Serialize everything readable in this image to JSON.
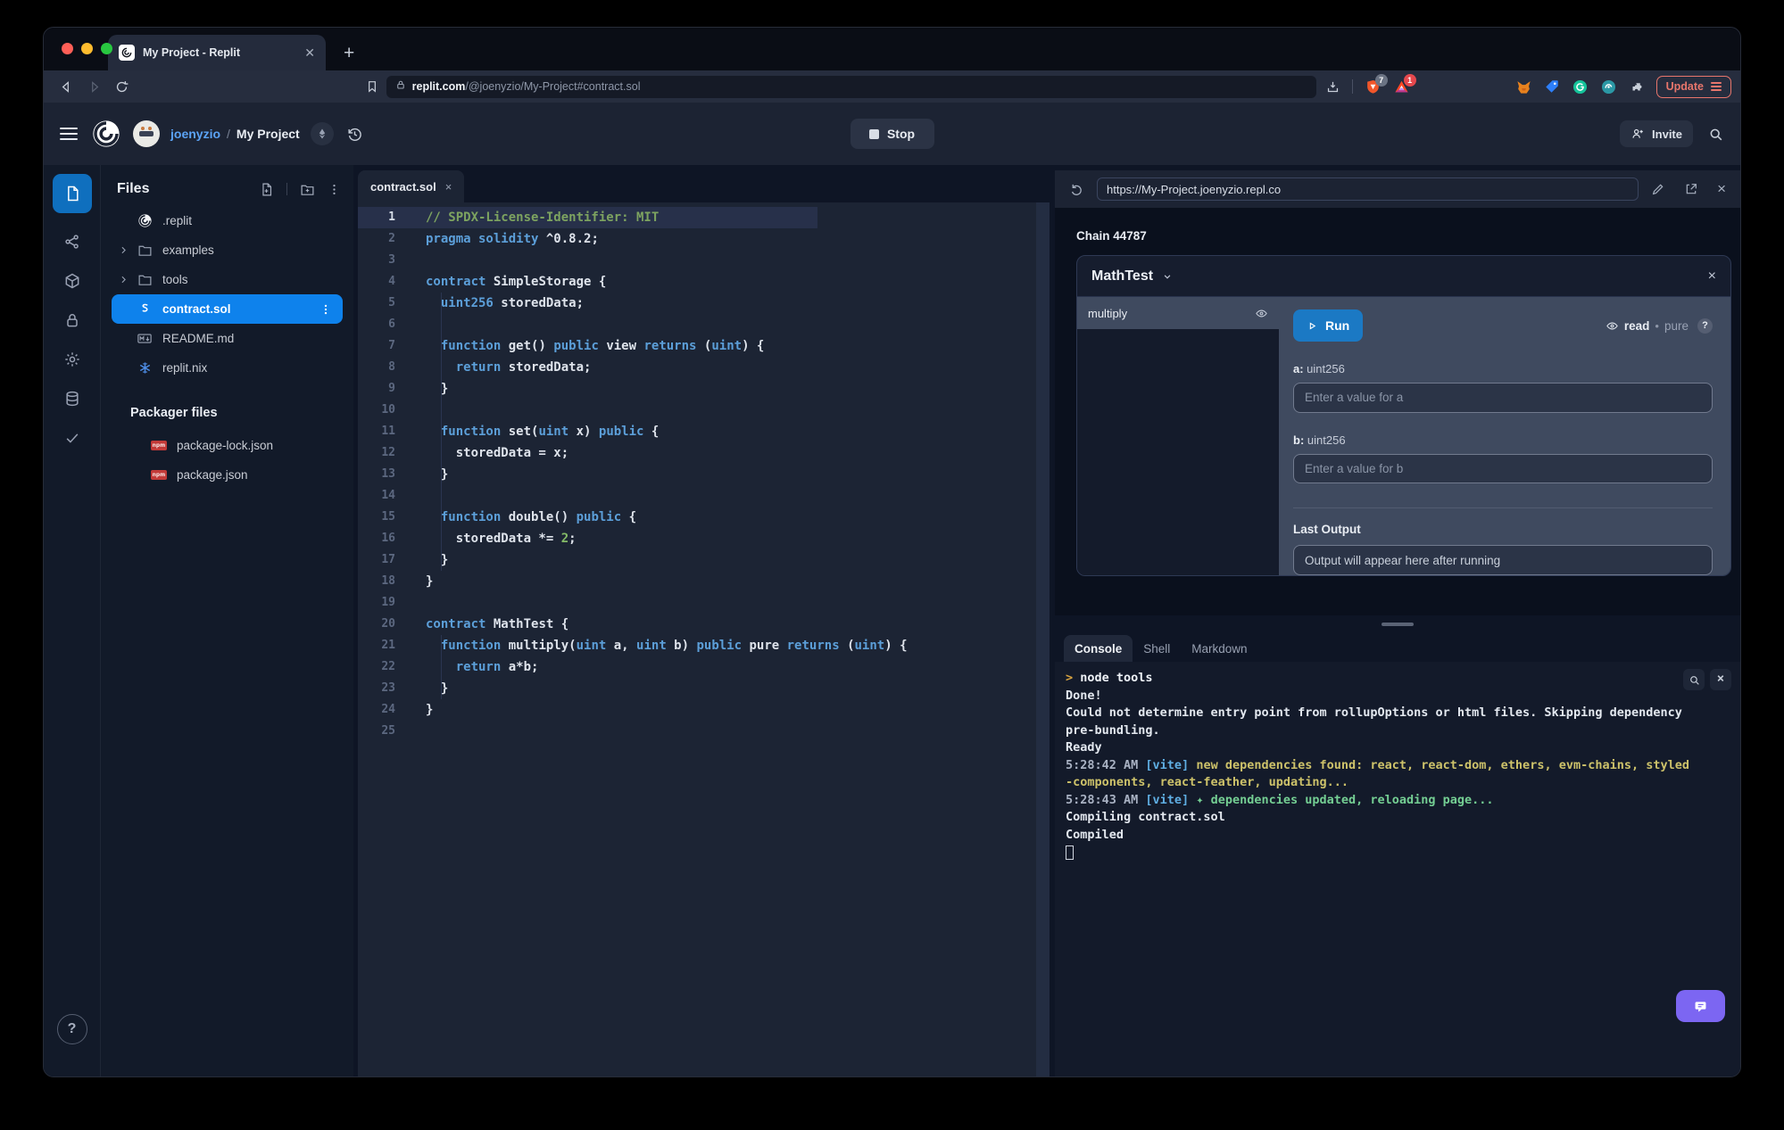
{
  "browser": {
    "tab_title": "My Project - Replit",
    "new_tab_label": "+",
    "url_host": "replit.com",
    "url_path": "/@joenyzio/My-Project#contract.sol",
    "shield_badge": "7",
    "rewards_badge": "1",
    "update_label": "Update"
  },
  "header": {
    "username": "joenyzio",
    "separator": "/",
    "project": "My Project",
    "stop_label": "Stop",
    "invite_label": "Invite"
  },
  "rail": {
    "items": [
      "files",
      "version-control",
      "packages",
      "secrets",
      "settings",
      "database",
      "checks"
    ],
    "help_label": "?"
  },
  "files": {
    "title": "Files",
    "items": [
      {
        "name": ".replit",
        "icon": "replit"
      },
      {
        "name": "examples",
        "icon": "folder",
        "chevron": true
      },
      {
        "name": "tools",
        "icon": "folder",
        "chevron": true
      },
      {
        "name": "contract.sol",
        "icon": "solidity",
        "selected": true
      },
      {
        "name": "README.md",
        "icon": "markdown"
      },
      {
        "name": "replit.nix",
        "icon": "nix"
      }
    ],
    "section_title": "Packager files",
    "packager_items": [
      {
        "name": "package-lock.json",
        "icon": "npm"
      },
      {
        "name": "package.json",
        "icon": "npm"
      }
    ]
  },
  "editor": {
    "tab": "contract.sol",
    "tab_close": "×",
    "lines": [
      {
        "n": 1,
        "cur": true,
        "t": [
          [
            "cm",
            "// SPDX-License-Identifier: MIT"
          ]
        ]
      },
      {
        "n": 2,
        "t": [
          [
            "kw",
            "pragma solidity"
          ],
          [
            "pl",
            " ^0.8.2;"
          ]
        ]
      },
      {
        "n": 3,
        "t": []
      },
      {
        "n": 4,
        "t": [
          [
            "kw",
            "contract"
          ],
          [
            "pl",
            " SimpleStorage {"
          ]
        ]
      },
      {
        "n": 5,
        "g": 1,
        "t": [
          [
            "pl",
            "  "
          ],
          [
            "kw",
            "uint256"
          ],
          [
            "pl",
            " storedData;"
          ]
        ]
      },
      {
        "n": 6,
        "g": 1,
        "t": []
      },
      {
        "n": 7,
        "g": 1,
        "t": [
          [
            "pl",
            "  "
          ],
          [
            "kw",
            "function"
          ],
          [
            "pl",
            " get() "
          ],
          [
            "kw",
            "public"
          ],
          [
            "pl",
            " view "
          ],
          [
            "kw",
            "returns"
          ],
          [
            "pl",
            " ("
          ],
          [
            "kw",
            "uint"
          ],
          [
            "pl",
            ") {"
          ]
        ]
      },
      {
        "n": 8,
        "g": 1,
        "t": [
          [
            "pl",
            "    "
          ],
          [
            "kw",
            "return"
          ],
          [
            "pl",
            " storedData;"
          ]
        ]
      },
      {
        "n": 9,
        "g": 1,
        "t": [
          [
            "pl",
            "  }"
          ]
        ]
      },
      {
        "n": 10,
        "g": 1,
        "t": []
      },
      {
        "n": 11,
        "g": 1,
        "t": [
          [
            "pl",
            "  "
          ],
          [
            "kw",
            "function"
          ],
          [
            "pl",
            " set("
          ],
          [
            "kw",
            "uint"
          ],
          [
            "pl",
            " x) "
          ],
          [
            "kw",
            "public"
          ],
          [
            "pl",
            " {"
          ]
        ]
      },
      {
        "n": 12,
        "g": 1,
        "t": [
          [
            "pl",
            "    storedData = x;"
          ]
        ]
      },
      {
        "n": 13,
        "g": 1,
        "t": [
          [
            "pl",
            "  }"
          ]
        ]
      },
      {
        "n": 14,
        "g": 1,
        "t": []
      },
      {
        "n": 15,
        "g": 1,
        "t": [
          [
            "pl",
            "  "
          ],
          [
            "kw",
            "function"
          ],
          [
            "pl",
            " double() "
          ],
          [
            "kw",
            "public"
          ],
          [
            "pl",
            " {"
          ]
        ]
      },
      {
        "n": 16,
        "g": 1,
        "t": [
          [
            "pl",
            "    storedData *= "
          ],
          [
            "num",
            "2"
          ],
          [
            "pl",
            ";"
          ]
        ]
      },
      {
        "n": 17,
        "g": 1,
        "t": [
          [
            "pl",
            "  }"
          ]
        ]
      },
      {
        "n": 18,
        "t": [
          [
            "pl",
            "}"
          ]
        ]
      },
      {
        "n": 19,
        "t": []
      },
      {
        "n": 20,
        "t": [
          [
            "kw",
            "contract"
          ],
          [
            "pl",
            " MathTest {"
          ]
        ]
      },
      {
        "n": 21,
        "g": 1,
        "t": [
          [
            "pl",
            "  "
          ],
          [
            "kw",
            "function"
          ],
          [
            "pl",
            " multiply("
          ],
          [
            "kw",
            "uint"
          ],
          [
            "pl",
            " a, "
          ],
          [
            "kw",
            "uint"
          ],
          [
            "pl",
            " b) "
          ],
          [
            "kw",
            "public"
          ],
          [
            "pl",
            " pure "
          ],
          [
            "kw",
            "returns"
          ],
          [
            "pl",
            " ("
          ],
          [
            "kw",
            "uint"
          ],
          [
            "pl",
            ") {"
          ]
        ]
      },
      {
        "n": 22,
        "g": 1,
        "t": [
          [
            "pl",
            "    "
          ],
          [
            "kw",
            "return"
          ],
          [
            "pl",
            " a*b;"
          ]
        ]
      },
      {
        "n": 23,
        "g": 1,
        "t": [
          [
            "pl",
            "  }"
          ]
        ]
      },
      {
        "n": 24,
        "t": [
          [
            "pl",
            "}"
          ]
        ]
      },
      {
        "n": 25,
        "t": []
      }
    ]
  },
  "webview": {
    "url": "https://My-Project.joenyzio.repl.co",
    "chain_label": "Chain 44787",
    "contract_name": "MathTest",
    "close_label": "×",
    "methods": [
      {
        "name": "multiply",
        "selected": true
      }
    ],
    "run_label": "Run",
    "state_read": "read",
    "state_dot": "•",
    "state_pure": "pure",
    "help_label": "?",
    "fields": [
      {
        "label": "a:",
        "type": " uint256",
        "placeholder": "Enter a value for a"
      },
      {
        "label": "b:",
        "type": " uint256",
        "placeholder": "Enter a value for b"
      }
    ],
    "last_output_label": "Last Output",
    "output_placeholder": "Output will appear here after running"
  },
  "console": {
    "tabs": [
      {
        "label": "Console",
        "active": true
      },
      {
        "label": "Shell",
        "active": false
      },
      {
        "label": "Markdown",
        "active": false
      }
    ],
    "lines": [
      [
        [
          "prompt",
          "> "
        ],
        [
          "cmd",
          "node tools"
        ]
      ],
      [
        [
          "pl",
          "Done!"
        ]
      ],
      [
        [
          "pl",
          "Could not determine entry point from rollupOptions or html files. Skipping dependency"
        ]
      ],
      [
        [
          "pl",
          "pre-bundling."
        ]
      ],
      [
        [
          "pl",
          "Ready"
        ]
      ],
      [
        [
          "ts",
          "5:28:42 AM "
        ],
        [
          "vite",
          "[vite]"
        ],
        [
          "warn",
          " new dependencies found: react, react-dom, ethers, evm-chains, styled"
        ]
      ],
      [
        [
          "warn",
          "-components, react-feather, updating..."
        ]
      ],
      [
        [
          "ts",
          "5:28:43 AM "
        ],
        [
          "vite",
          "[vite]"
        ],
        [
          "ok",
          " ✦ dependencies updated, reloading page..."
        ]
      ],
      [
        [
          "pl",
          "Compiling contract.sol"
        ]
      ],
      [
        [
          "pl",
          "Compiled"
        ]
      ]
    ],
    "cursor": true
  },
  "colors": {
    "file_selected": "#0E82EC",
    "rail_active": "#0F6FBE",
    "run": "#1B79C4",
    "chat": "#7C66F2",
    "update": "#E8766C",
    "kw": "#5C9FD9",
    "comment": "#7DA360",
    "number": "#84BB67",
    "console_warn": "#CDC26A",
    "console_ok": "#74CE93",
    "console_vite": "#5FAEE3",
    "console_prompt": "#D9A441",
    "username": "#5BA3F5",
    "nix": "#4E8EE8",
    "npm": "#C23A38"
  }
}
